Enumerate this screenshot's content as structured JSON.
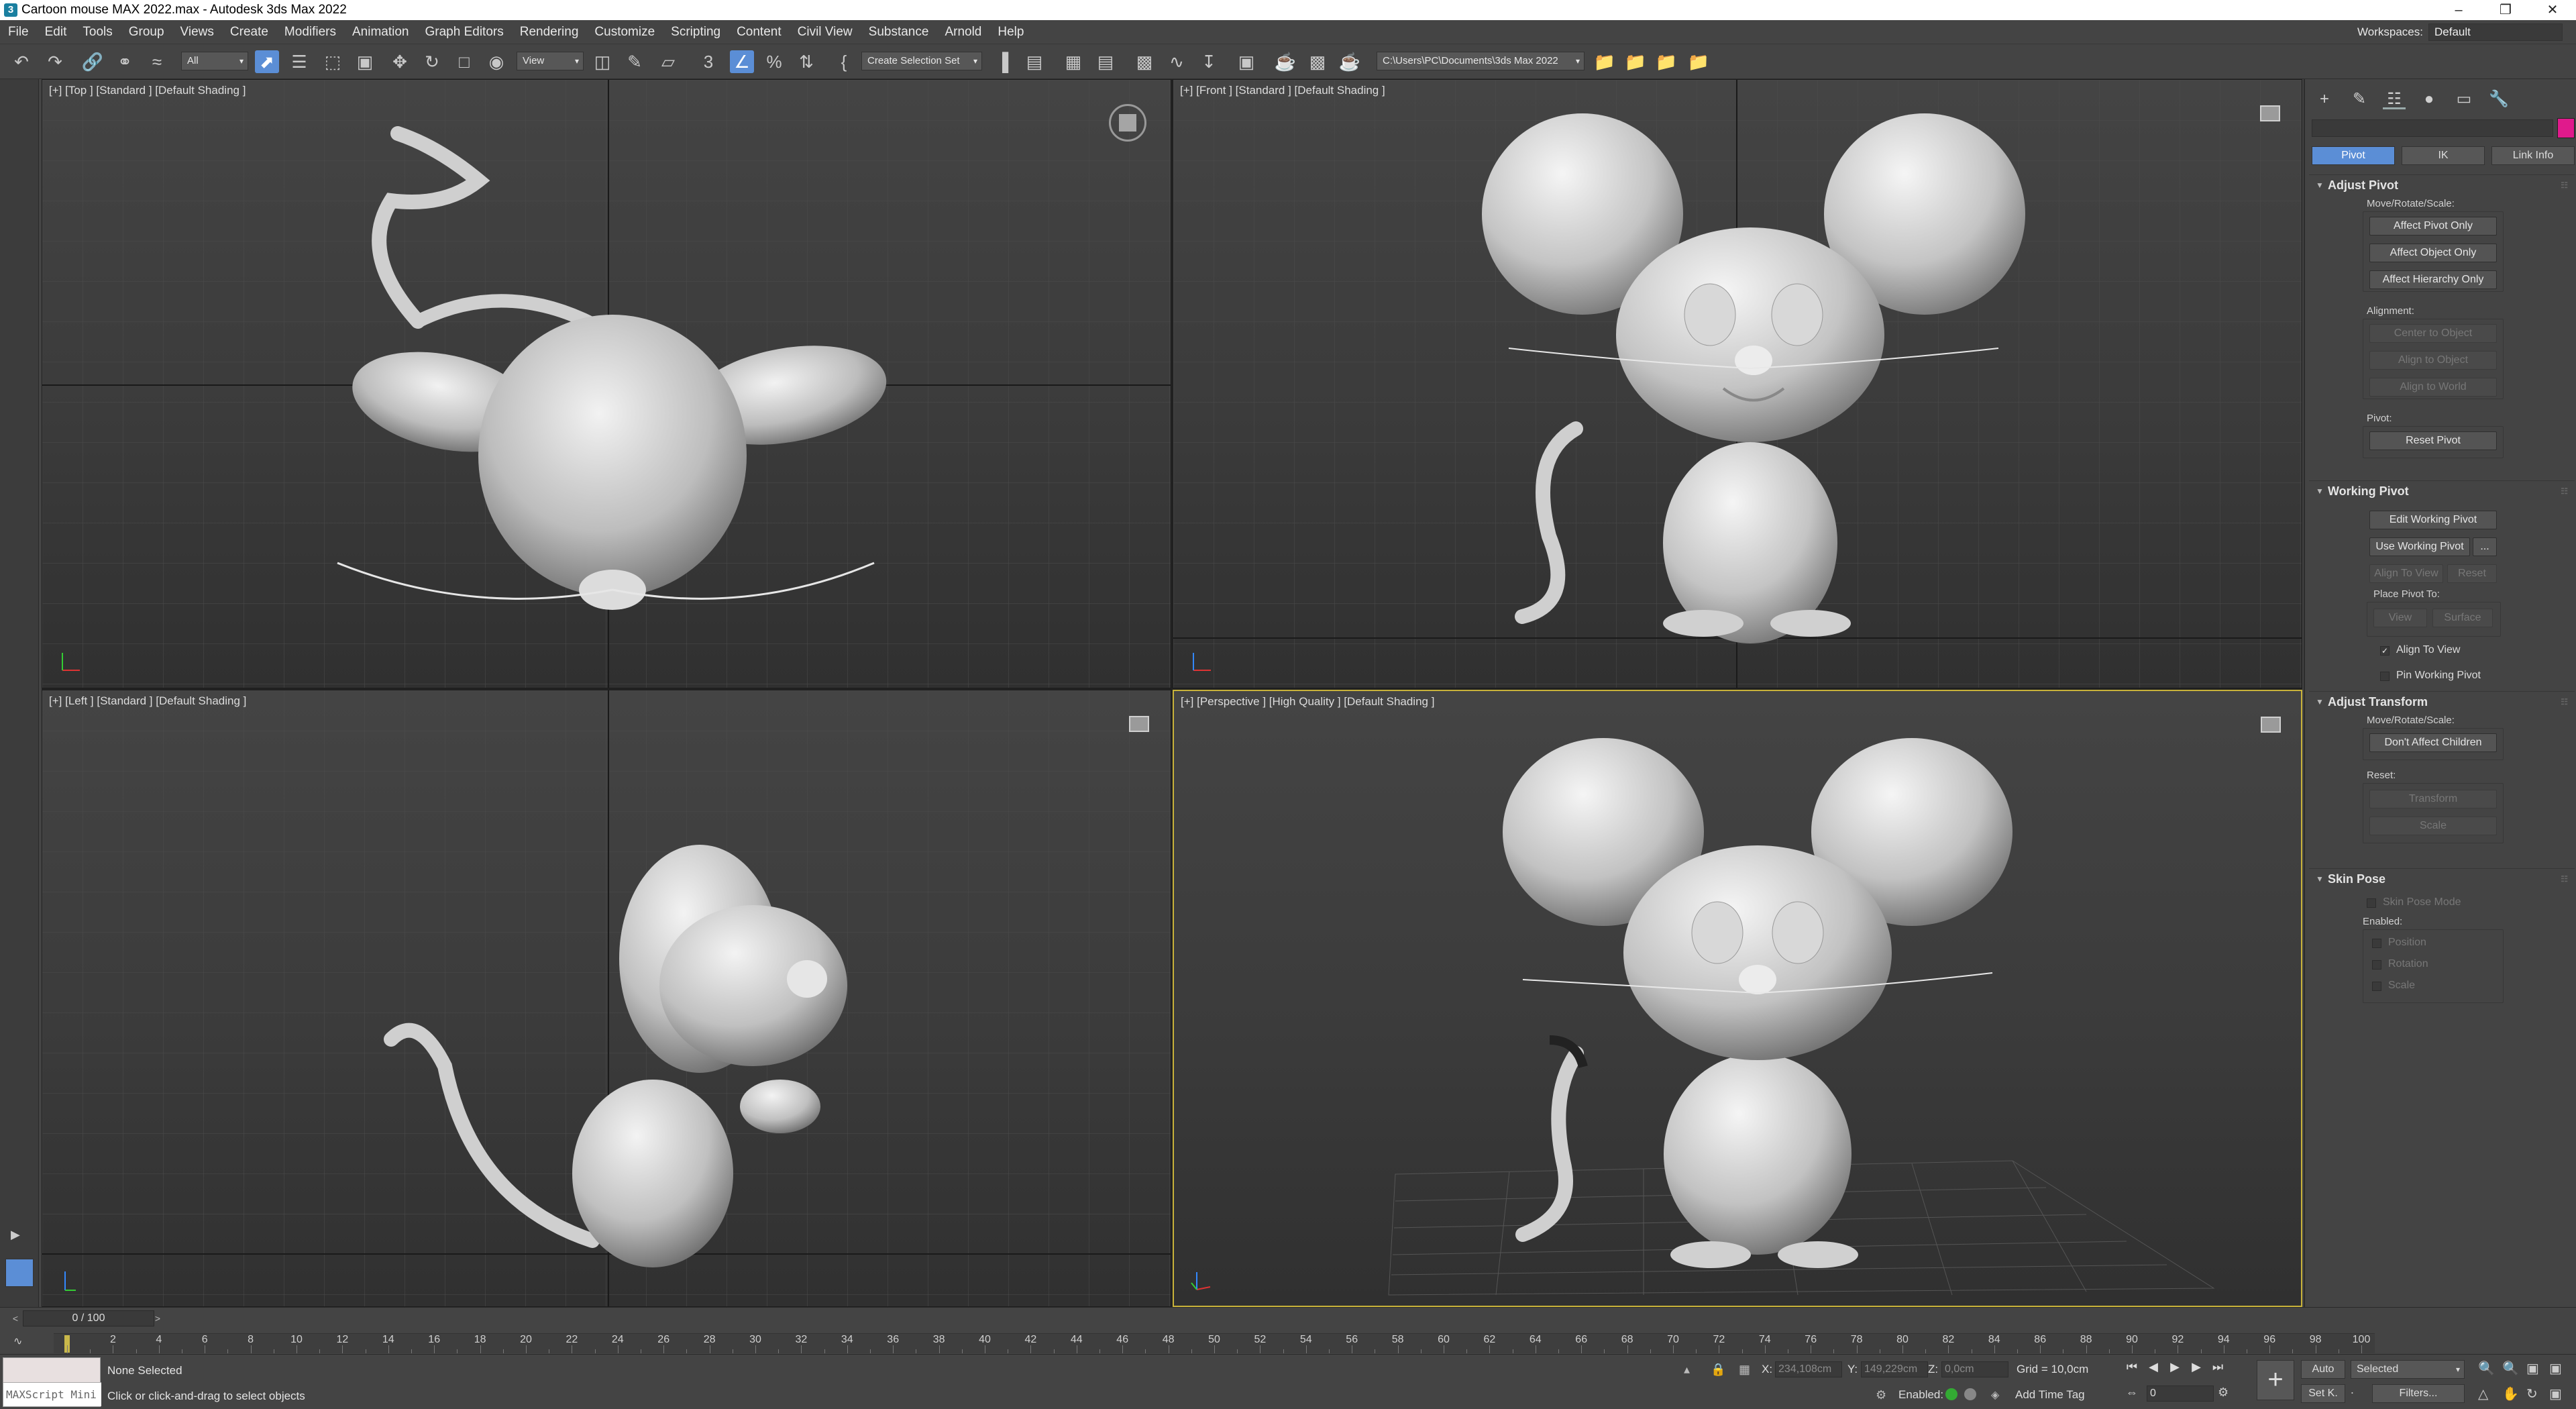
{
  "window": {
    "title": "Cartoon mouse MAX 2022.max - Autodesk 3ds Max 2022",
    "app_icon": "3"
  },
  "menu": [
    "File",
    "Edit",
    "Tools",
    "Group",
    "Views",
    "Create",
    "Modifiers",
    "Animation",
    "Graph Editors",
    "Rendering",
    "Customize",
    "Scripting",
    "Content",
    "Civil View",
    "Substance",
    "Arnold",
    "Help"
  ],
  "workspaces": {
    "label": "Workspaces:",
    "value": "Default"
  },
  "toolbar": {
    "filter": "All",
    "ref_coord": "View",
    "selection_set": "Create Selection Set",
    "project_path": "C:\\Users\\PC\\Documents\\3ds Max 2022",
    "accent": "#5b8ed6"
  },
  "viewports": [
    {
      "id": "top",
      "label": "[+] [Top ] [Standard ] [Default Shading ]"
    },
    {
      "id": "front",
      "label": "[+] [Front ] [Standard ] [Default Shading ]"
    },
    {
      "id": "left",
      "label": "[+] [Left ] [Standard ] [Default Shading ]"
    },
    {
      "id": "perspective",
      "label": "[+] [Perspective ] [High Quality ] [Default Shading ]"
    }
  ],
  "command_panel": {
    "object_color": "#e01a8c",
    "mode_buttons": [
      "Pivot",
      "IK",
      "Link Info"
    ],
    "adjust_pivot": {
      "title": "Adjust Pivot",
      "move_label": "Move/Rotate/Scale:",
      "buttons": [
        "Affect Pivot Only",
        "Affect Object Only",
        "Affect Hierarchy Only"
      ],
      "alignment_label": "Alignment:",
      "align_buttons": [
        "Center to Object",
        "Align to Object",
        "Align to World"
      ],
      "pivot_label": "Pivot:",
      "reset_button": "Reset Pivot"
    },
    "working_pivot": {
      "title": "Working Pivot",
      "edit_button": "Edit Working Pivot",
      "use_button": "Use Working Pivot",
      "use_extra": "...",
      "align_view": "Align To View",
      "reset": "Reset",
      "place_label": "Place Pivot To:",
      "view": "View",
      "surface": "Surface",
      "align_to_view_check": "Align To View",
      "pin_check": "Pin Working Pivot"
    },
    "adjust_transform": {
      "title": "Adjust Transform",
      "move_label": "Move/Rotate/Scale:",
      "dont_affect": "Don't Affect Children",
      "reset_label": "Reset:",
      "transform": "Transform",
      "scale": "Scale"
    },
    "skin_pose": {
      "title": "Skin Pose",
      "mode": "Skin Pose Mode",
      "enabled_label": "Enabled:",
      "position": "Position",
      "rotation": "Rotation",
      "scale": "Scale"
    }
  },
  "timeline": {
    "frame_display": "0 / 100",
    "current_frame": 0,
    "tick_labels": [
      "0",
      "2",
      "4",
      "6",
      "8",
      "10",
      "12",
      "14",
      "16",
      "18",
      "20",
      "22",
      "24",
      "26",
      "28",
      "30",
      "32",
      "34",
      "36",
      "38",
      "40",
      "42",
      "44",
      "46",
      "48",
      "50",
      "52",
      "54",
      "56",
      "58",
      "60",
      "62",
      "64",
      "66",
      "68",
      "70",
      "72",
      "74",
      "76",
      "78",
      "80",
      "82",
      "84",
      "86",
      "88",
      "90",
      "92",
      "94",
      "96",
      "98",
      "100"
    ]
  },
  "status": {
    "maxscript": "MAXScript Mini",
    "selection": "None Selected",
    "prompt": "Click or click-and-drag to select objects",
    "x_label": "X:",
    "x_value": "234,108cm",
    "y_label": "Y:",
    "y_value": "149,229cm",
    "z_label": "Z:",
    "z_value": "0,0cm",
    "grid": "Grid = 10,0cm",
    "enabled_label": "Enabled:",
    "add_time_tag": "Add Time Tag",
    "auto": "Auto",
    "set_key": "Set K.",
    "key_mode": "Selected",
    "filters": "Filters...",
    "frame_field": "0"
  }
}
